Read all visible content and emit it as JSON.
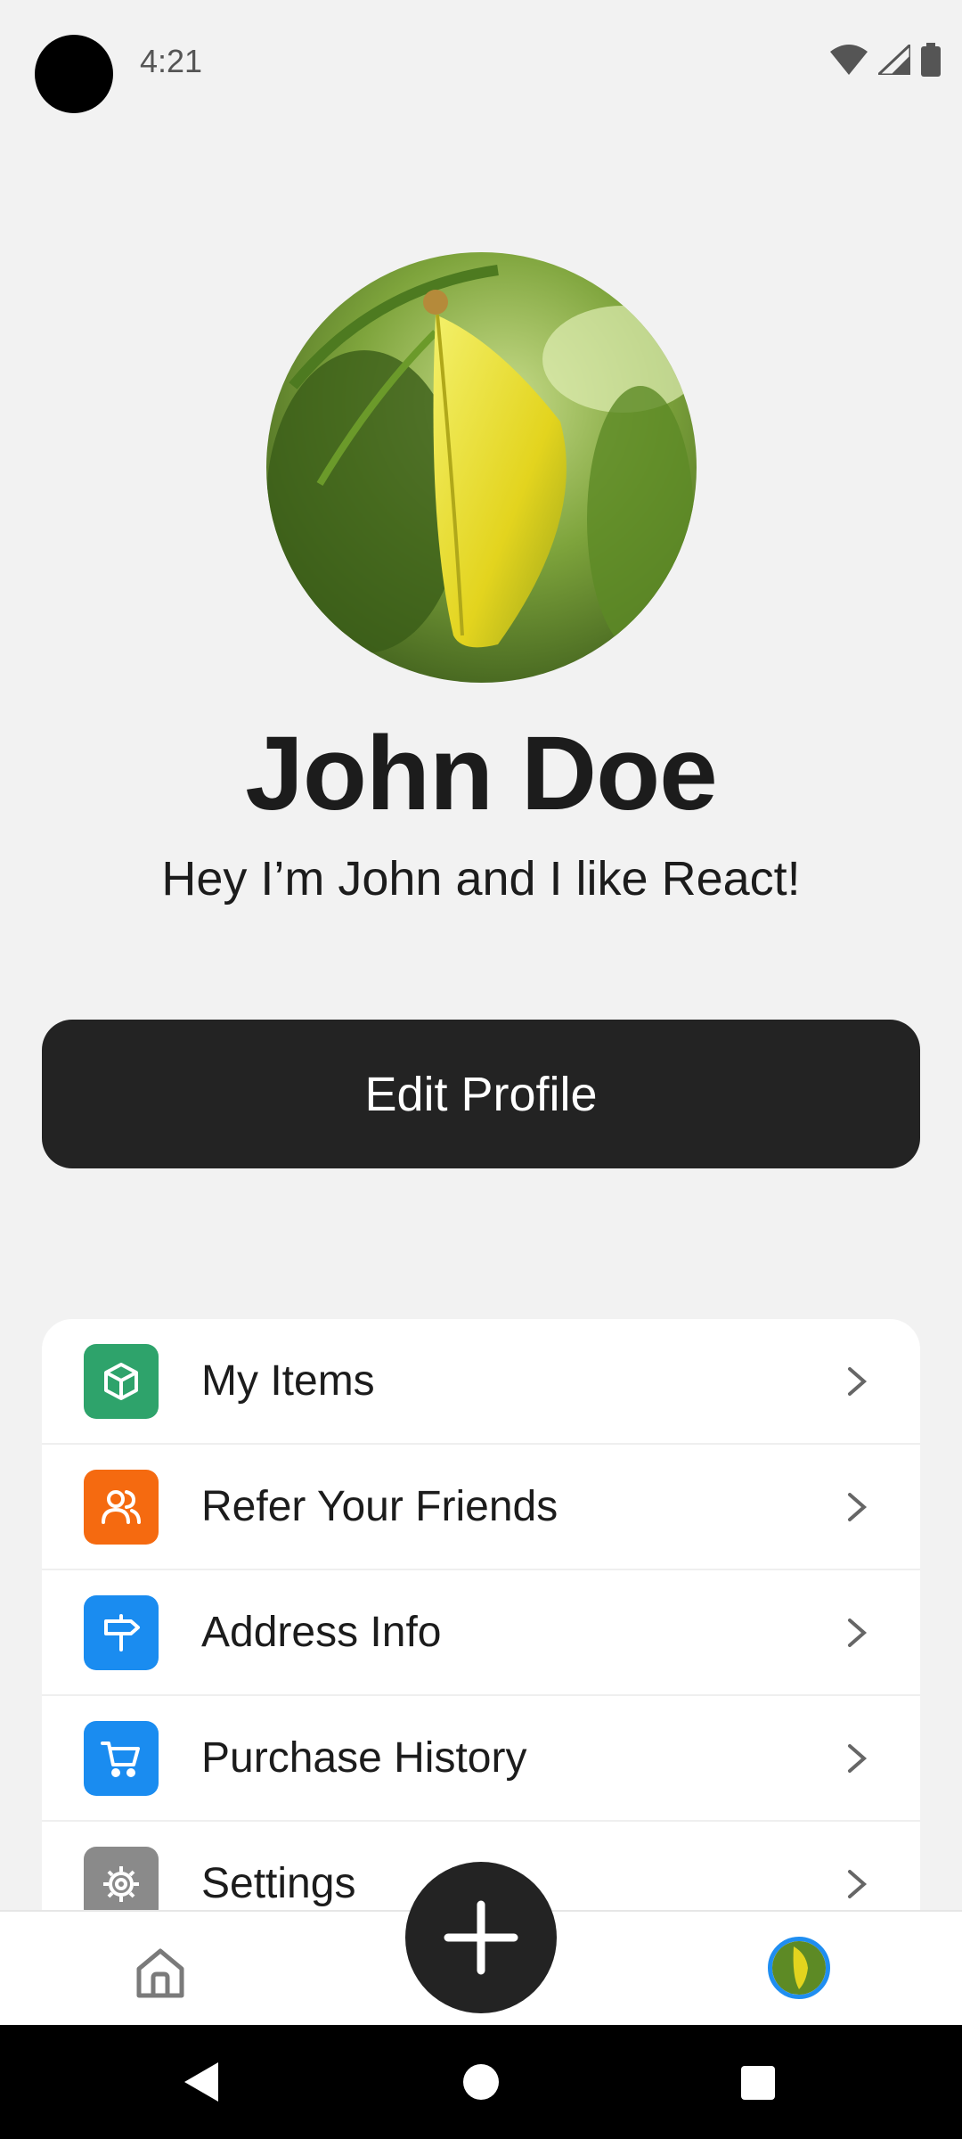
{
  "status_bar": {
    "time": "4:21",
    "icons": [
      "wifi-icon",
      "cell-signal-icon",
      "battery-icon"
    ]
  },
  "profile": {
    "avatar": "leaf-photo-avatar",
    "name": "John Doe",
    "bio": "Hey I’m John and I like React!",
    "edit_button_label": "Edit Profile"
  },
  "menu": {
    "items": [
      {
        "label": "My Items",
        "icon": "box-icon",
        "color": "#2ea36b"
      },
      {
        "label": "Refer Your Friends",
        "icon": "users-icon",
        "color": "#f56a10"
      },
      {
        "label": "Address Info",
        "icon": "signpost-icon",
        "color": "#1a8cf0"
      },
      {
        "label": "Purchase History",
        "icon": "cart-icon",
        "color": "#1a8cf0"
      },
      {
        "label": "Settings",
        "icon": "gear-icon",
        "color": "#8a8a8a"
      }
    ]
  },
  "tab_bar": {
    "tabs": [
      "home-icon",
      "add-icon",
      "profile-avatar"
    ],
    "active_color": "#1f8ef1"
  },
  "system_nav": [
    "back-icon",
    "home-icon",
    "recents-icon"
  ]
}
